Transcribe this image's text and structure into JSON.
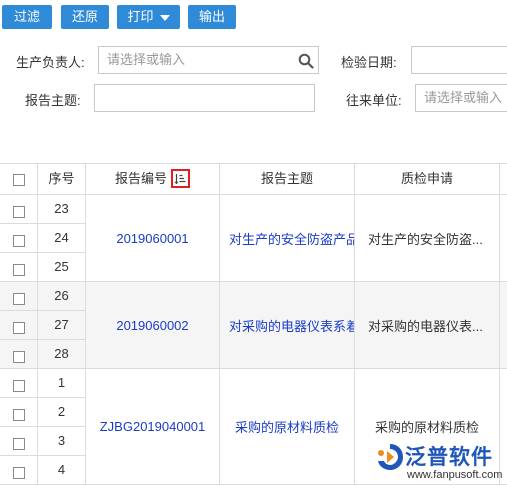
{
  "toolbar": {
    "filter_label": "过滤",
    "restore_label": "还原",
    "print_label": "打印",
    "export_label": "输出"
  },
  "filters": {
    "owner_label": "生产负责人:",
    "owner_placeholder": "请选择或输入",
    "date_label": "检验日期:",
    "subject_label": "报告主题:",
    "partner_label": "往来单位:",
    "partner_placeholder": "请选择或输入"
  },
  "table": {
    "columns": {
      "seq": "序号",
      "code": "报告编号",
      "subject": "报告主题",
      "inspection": "质检申请"
    },
    "groups": [
      {
        "code": "2019060001",
        "subject": "对生产的安全防盗产品",
        "inspection": "对生产的安全防盗...",
        "rows": [
          "23",
          "24",
          "25"
        ]
      },
      {
        "code": "2019060002",
        "subject": "对采购的电器仪表系着",
        "inspection": "对采购的电器仪表...",
        "rows": [
          "26",
          "27",
          "28"
        ]
      },
      {
        "code": "ZJBG2019040001",
        "subject": "采购的原材料质检",
        "inspection": "采购的原材料质检",
        "rows": [
          "1",
          "2",
          "3",
          "4"
        ]
      }
    ]
  },
  "watermark": {
    "brand": "泛普软件",
    "url": "www.fanpusoft.com"
  },
  "colors": {
    "button": "#2f8ad8",
    "link": "#1a3cc8",
    "sort_highlight": "#e02020",
    "brand": "#1f56b8"
  }
}
